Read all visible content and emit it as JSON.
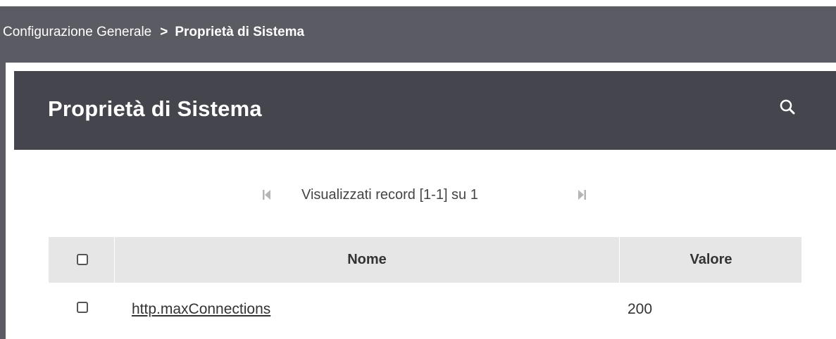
{
  "breadcrumb": {
    "parent": "Configurazione Generale",
    "separator": ">",
    "current": "Proprietà di Sistema"
  },
  "panel": {
    "title": "Proprietà di Sistema",
    "search_icon": "search-icon"
  },
  "pager": {
    "info": "Visualizzati record [1-1] su 1",
    "first_icon": "first-page-icon",
    "last_icon": "last-page-icon"
  },
  "table": {
    "columns": [
      "Nome",
      "Valore"
    ],
    "rows": [
      {
        "nome": "http.maxConnections",
        "valore": "200"
      }
    ]
  },
  "colors": {
    "breadcrumb_bg": "#5b5b63",
    "header_bg": "#45454d",
    "table_header_bg": "#e6e6e6"
  }
}
